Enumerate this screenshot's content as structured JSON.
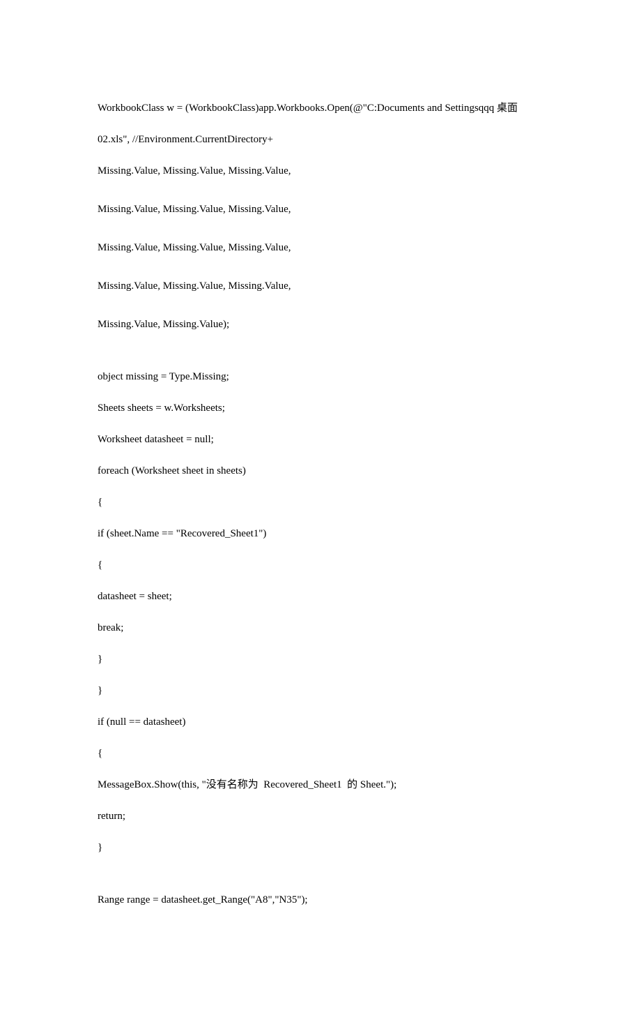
{
  "lines": [
    "WorkbookClass w = (WorkbookClass)app.Workbooks.Open(@\"C:Documents and Settingsqqq 桌面",
    "02.xls\", //Environment.CurrentDirectory+",
    "Missing.Value, Missing.Value, Missing.Value,",
    "Missing.Value, Missing.Value, Missing.Value,",
    "Missing.Value, Missing.Value, Missing.Value,",
    "Missing.Value, Missing.Value, Missing.Value,",
    "Missing.Value, Missing.Value);",
    "object missing = Type.Missing;",
    "Sheets sheets = w.Worksheets;",
    "Worksheet datasheet = null;",
    "foreach (Worksheet sheet in sheets)",
    "{",
    "if (sheet.Name == \"Recovered_Sheet1\")",
    "{",
    "datasheet = sheet;",
    "break;",
    "}",
    "}",
    "if (null == datasheet)",
    "{",
    "MessageBox.Show(this, \"没有名称为  Recovered_Sheet1  的 Sheet.\");",
    "return;",
    "}",
    "Range range = datasheet.get_Range(\"A8\",\"N35\");"
  ]
}
